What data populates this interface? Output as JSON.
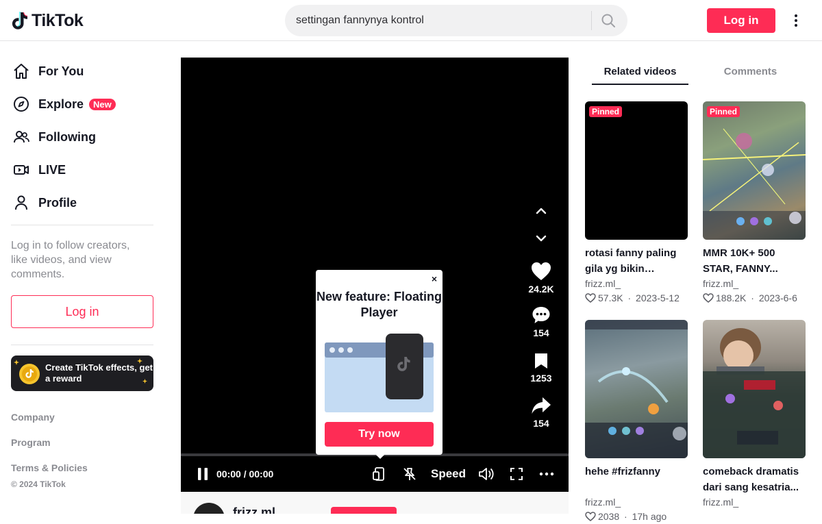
{
  "header": {
    "logo_text": "TikTok",
    "search_value": "settingan fannynya kontrol",
    "login_label": "Log in"
  },
  "sidebar": {
    "items": [
      {
        "label": "For You",
        "icon": "home-icon"
      },
      {
        "label": "Explore",
        "icon": "compass-icon",
        "badge": "New"
      },
      {
        "label": "Following",
        "icon": "people-icon"
      },
      {
        "label": "LIVE",
        "icon": "live-icon"
      },
      {
        "label": "Profile",
        "icon": "person-icon"
      }
    ],
    "note": "Log in to follow creators, like videos, and view comments.",
    "login_label": "Log in",
    "effects_banner": "Create TikTok effects, get a reward",
    "footer_links": [
      "Company",
      "Program",
      "Terms & Policies"
    ],
    "copyright": "© 2024 TikTok"
  },
  "player": {
    "likes": "24.2K",
    "comments": "154",
    "saves": "1253",
    "shares": "154",
    "time": "00:00 / 00:00",
    "speed_label": "Speed",
    "popup": {
      "title": "New feature: Floating Player",
      "button": "Try now",
      "close": "×"
    },
    "author": "frizz.ml"
  },
  "right": {
    "tabs": [
      "Related videos",
      "Comments"
    ],
    "cards": [
      {
        "pinned": "Pinned",
        "title": "rotasi fanny paling gila yg bikin musuh...",
        "author": "frizz.ml_",
        "likes": "57.3K",
        "date": "2023-5-12"
      },
      {
        "pinned": "Pinned",
        "title": "MMR 10K+ 500 STAR, FANNY...",
        "author": "frizz.ml_",
        "likes": "188.2K",
        "date": "2023-6-6"
      },
      {
        "title": "hehe #frizfanny",
        "author": "frizz.ml_",
        "likes": "2038",
        "date": "17h ago"
      },
      {
        "title": "comeback dramatis dari sang kesatria...",
        "author": "frizz.ml_"
      }
    ]
  },
  "colors": {
    "accent": "#fe2c55",
    "text": "#161823",
    "muted": "#8a8b91"
  }
}
